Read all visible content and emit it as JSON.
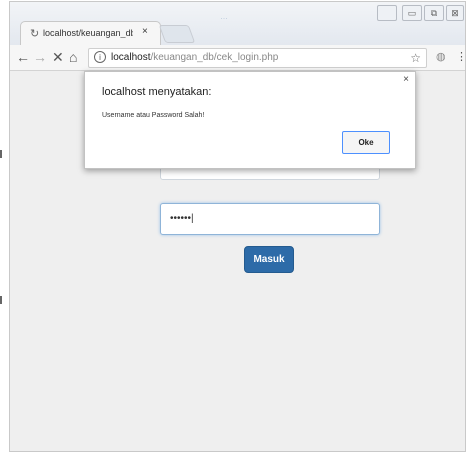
{
  "tab": {
    "title": "localhost/keuangan_db/",
    "close": "×"
  },
  "titlebar": {
    "blurred_text": "…"
  },
  "window_controls": {
    "user": "",
    "minimize": "▭",
    "maximize": "⧉",
    "close": "⊠"
  },
  "toolbar": {
    "back": "←",
    "forward": "→",
    "stop": "✕",
    "home": "⌂",
    "info": "i",
    "url_host": "localhost",
    "url_path": "/keuangan_db/cek_login.php",
    "star": "☆",
    "extension": "◍",
    "menu": "⋮"
  },
  "dialog": {
    "title": "localhost menyatakan:",
    "message": "Username atau Password Salah!",
    "close": "×",
    "ok_label": "Oke"
  },
  "form": {
    "password_value": "••••••|",
    "submit_label": "Masuk"
  },
  "colors": {
    "primary_button": "#2d6ba8",
    "dialog_ok_border": "#4d90fe",
    "page_bg": "#efefef"
  },
  "icons": {
    "tab_favicon": "loading-icon"
  }
}
